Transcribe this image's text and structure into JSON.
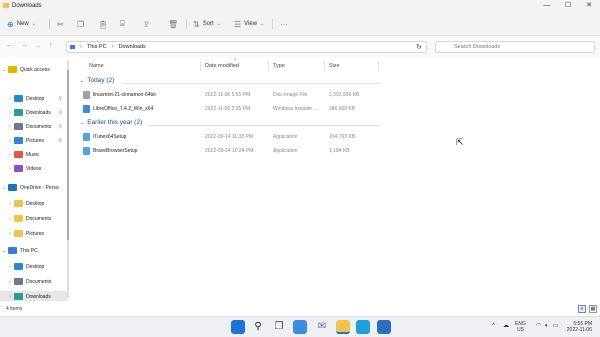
{
  "window": {
    "title": "Downloads",
    "controls": [
      "—",
      "☐",
      "✕"
    ]
  },
  "toolbar": {
    "new_label": "New",
    "sort_label": "Sort",
    "view_label": "View",
    "more_label": "···"
  },
  "address": {
    "path": [
      "This PC",
      "Downloads"
    ],
    "search_placeholder": "Search Downloads"
  },
  "sidebar": [
    {
      "label": "Quick access",
      "type": "section",
      "icon": "star-icon",
      "color": "#e8b400"
    },
    {
      "label": "Desktop",
      "type": "item",
      "icon": "desktop-icon",
      "color": "#2b87d1",
      "pinned": true
    },
    {
      "label": "Downloads",
      "type": "item",
      "icon": "download-icon",
      "color": "#2a9d8f",
      "pinned": true
    },
    {
      "label": "Documents",
      "type": "item",
      "icon": "documents-icon",
      "color": "#6c7a89",
      "pinned": true
    },
    {
      "label": "Pictures",
      "type": "item",
      "icon": "pictures-icon",
      "color": "#2b87d1",
      "pinned": true
    },
    {
      "label": "Music",
      "type": "item",
      "icon": "music-icon",
      "color": "#e25a3a",
      "pinned": false
    },
    {
      "label": "Videos",
      "type": "item",
      "icon": "videos-icon",
      "color": "#8a4fcf",
      "pinned": false
    },
    {
      "label": "OneDrive - Perso",
      "type": "section",
      "icon": "onedrive-icon",
      "color": "#1e73c7"
    },
    {
      "label": "Desktop",
      "type": "item",
      "icon": "folder-icon",
      "color": "#f2c14e",
      "pinned": false
    },
    {
      "label": "Documents",
      "type": "item",
      "icon": "folder-icon",
      "color": "#f2c14e",
      "pinned": false
    },
    {
      "label": "Pictures",
      "type": "item",
      "icon": "folder-icon",
      "color": "#f2c14e",
      "pinned": false
    },
    {
      "label": "This PC",
      "type": "section",
      "icon": "computer-icon",
      "color": "#3a7bd5"
    },
    {
      "label": "Desktop",
      "type": "item",
      "icon": "desktop-icon",
      "color": "#2b87d1",
      "pinned": false
    },
    {
      "label": "Documents",
      "type": "item",
      "icon": "documents-icon",
      "color": "#6c7a89",
      "pinned": false
    },
    {
      "label": "Downloads",
      "type": "item",
      "icon": "download-icon",
      "color": "#2a9d8f",
      "pinned": false,
      "selected": true
    }
  ],
  "columns": [
    "Name",
    "Date modified",
    "Type",
    "Size"
  ],
  "groups": [
    {
      "label": "Today (2)",
      "files": [
        {
          "name": "linuxmint-21-cinnamon-64bit",
          "date": "2022-11-06 5:55 PM",
          "type": "Disc Image File",
          "size": "2,391,936 KB",
          "icon": "disc-image-icon",
          "color": "#9aa3ad"
        },
        {
          "name": "LibreOffice_7.4.2_Win_x64",
          "date": "2022-11-06 2:35 PM",
          "type": "Windows Installer ...",
          "size": "346,668 KB",
          "icon": "installer-icon",
          "color": "#3c8dd6"
        }
      ]
    },
    {
      "label": "Earlier this year (2)",
      "files": [
        {
          "name": "iTunes64Setup",
          "date": "2022-09-14 11:33 PM",
          "type": "Application",
          "size": "194,763 KB",
          "icon": "application-icon",
          "color": "#5aa0e0"
        },
        {
          "name": "BraveBrowserSetup",
          "date": "2022-09-14 10:24 PM",
          "type": "Application",
          "size": "1,184 KB",
          "icon": "application-icon",
          "color": "#5aa0e0"
        }
      ]
    }
  ],
  "status": {
    "item_count": "4 items"
  },
  "taskbar": {
    "apps": [
      {
        "name": "start-icon",
        "color": "#1e74d6"
      },
      {
        "name": "search-icon",
        "color": "#222222"
      },
      {
        "name": "task-view-icon",
        "color": "#444444"
      },
      {
        "name": "widgets-icon",
        "color": "#3a8de0"
      },
      {
        "name": "chat-icon",
        "color": "#6264a7"
      },
      {
        "name": "file-explorer-icon",
        "color": "#f2c14e"
      },
      {
        "name": "edge-icon",
        "color": "#1f9ed8"
      },
      {
        "name": "store-icon",
        "color": "#2c6fbf"
      }
    ],
    "language": "ENG",
    "region": "US",
    "time": "5:55 PM",
    "date": "2022-11-06"
  }
}
